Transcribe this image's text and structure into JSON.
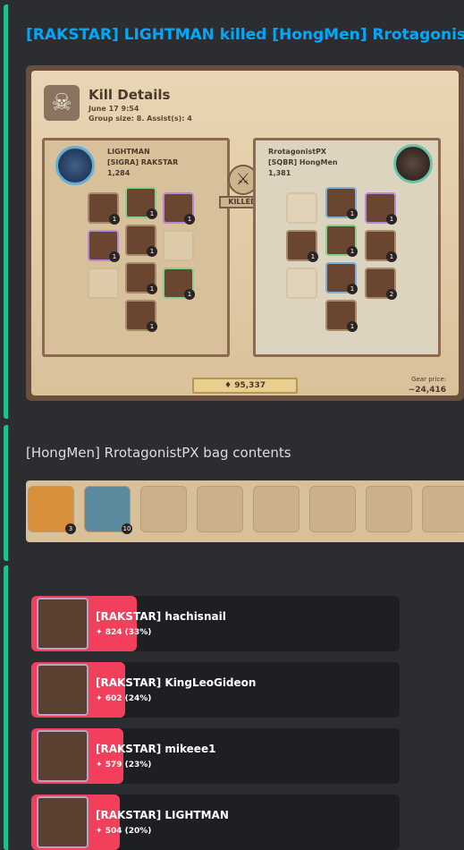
{
  "kill_embed": {
    "title": "[RAKSTAR] LIGHTMAN killed [HongMen] RrotagonistPX",
    "header": "Kill Details",
    "date": "June 17 9:54",
    "group": "Group size: 8. Assist(s): 4",
    "killer": {
      "name": "LIGHTMAN",
      "guild": "[SIGRA] RAKSTAR",
      "ip": "1,284",
      "level": "2"
    },
    "victim": {
      "name": "RrotagonistPX",
      "guild": "[SQBR] HongMen",
      "ip": "1,381"
    },
    "killed_label": "KILLED",
    "fame": "95,337",
    "gear_price_label": "Gear price:",
    "gear_price": "~24,416"
  },
  "bag": {
    "title": "[HongMen] RrotagonistPX bag contents",
    "slots": [
      "3",
      "10"
    ]
  },
  "damage": [
    {
      "name": "[RAKSTAR] hachisnail",
      "value": "824 (33%)",
      "fraction": 0.33
    },
    {
      "name": "[RAKSTAR] KingLeoGideon",
      "value": "602 (24%)",
      "fraction": 0.24
    },
    {
      "name": "[RAKSTAR] mikeee1",
      "value": "579 (23%)",
      "fraction": 0.23
    },
    {
      "name": "[RAKSTAR] LIGHTMAN",
      "value": "504 (20%)",
      "fraction": 0.2
    }
  ],
  "colors": {
    "accent": "#1fbf8f",
    "title": "#00a8fc",
    "damage_bar": "#f23f5c"
  }
}
